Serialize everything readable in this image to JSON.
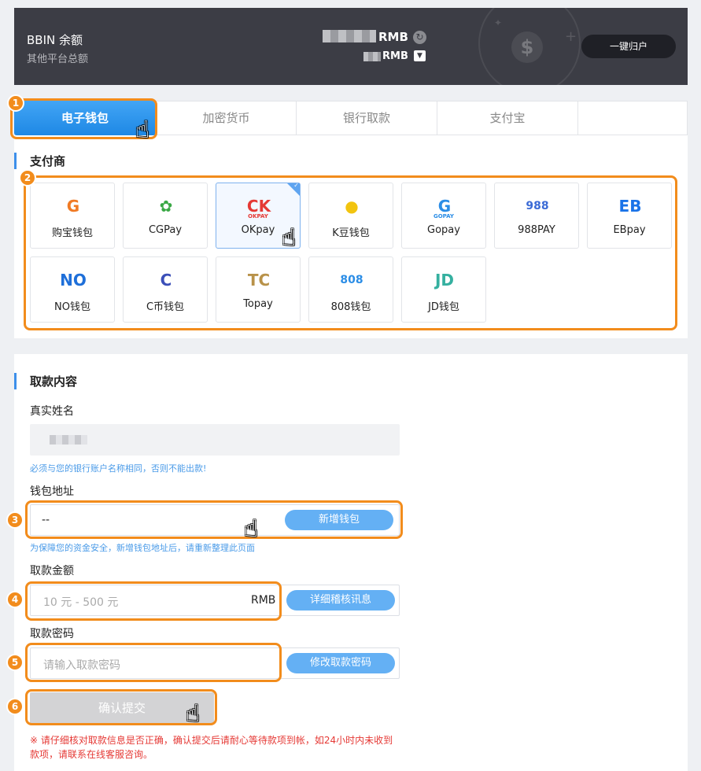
{
  "balance": {
    "title": "BBIN 余额",
    "subtitle": "其他平台总额",
    "currency_main": "RMB",
    "currency_other": "RMB",
    "recall_label": "一键归户"
  },
  "tabs": [
    {
      "label": "电子钱包",
      "active": true
    },
    {
      "label": "加密货币"
    },
    {
      "label": "银行取款"
    },
    {
      "label": "支付宝"
    }
  ],
  "providers_section": {
    "title": "支付商",
    "providers": [
      {
        "name": "购宝钱包",
        "logo_text": "G",
        "color": "#f07a24"
      },
      {
        "name": "CGPay",
        "logo_text": "✿",
        "color": "#3aa845"
      },
      {
        "name": "OKpay",
        "logo_text": "CK",
        "color": "#e53935",
        "selected": true,
        "logo_caption": "OKPAY"
      },
      {
        "name": "K豆钱包",
        "logo_text": "●",
        "color": "#f2c40f"
      },
      {
        "name": "Gopay",
        "logo_text": "G",
        "color": "#2b8de6",
        "logo_caption": "GOPAY"
      },
      {
        "name": "988PAY",
        "logo_text": "988",
        "color": "#3b6bd6"
      },
      {
        "name": "EBpay",
        "logo_text": "EB",
        "color": "#1a73e8"
      },
      {
        "name": "NO钱包",
        "logo_text": "NO",
        "color": "#1e6fd9"
      },
      {
        "name": "C币钱包",
        "logo_text": "C",
        "color": "#3b4fb8"
      },
      {
        "name": "Topay",
        "logo_text": "TC",
        "color": "#b8924a"
      },
      {
        "name": "808钱包",
        "logo_text": "808",
        "color": "#2b8de6"
      },
      {
        "name": "JD钱包",
        "logo_text": "JD",
        "color": "#35b0a0"
      }
    ]
  },
  "form": {
    "title": "取款内容",
    "name_label": "真实姓名",
    "name_hint": "必须与您的银行账户名称相同，否则不能出款!",
    "wallet_label": "钱包地址",
    "wallet_value": "--",
    "add_wallet_label": "新增钱包",
    "wallet_hint": "为保障您的资金安全，新增钱包地址后，请重新整理此页面",
    "amount_label": "取款金额",
    "amount_placeholder": "10 元 - 500 元",
    "amount_unit": "RMB",
    "audit_label": "详细稽核讯息",
    "password_label": "取款密码",
    "password_placeholder": "请输入取款密码",
    "change_password_label": "修改取款密码",
    "submit_label": "确认提交",
    "warning": "※ 请仔细核对取款信息是否正确，确认提交后请耐心等待款项到帐，如24小时内未收到款项，请联系在线客服咨询。"
  },
  "annotations": [
    "1",
    "2",
    "3",
    "4",
    "5",
    "6"
  ],
  "colors": {
    "accent": "#2b8de6",
    "highlight": "#f28c1c",
    "warning": "#e53935"
  }
}
